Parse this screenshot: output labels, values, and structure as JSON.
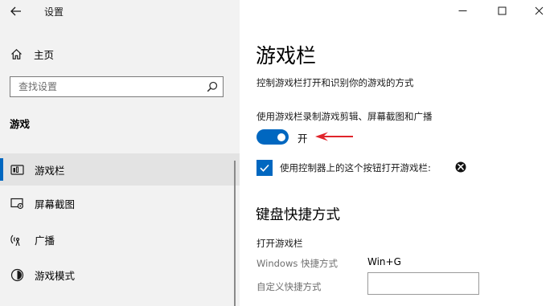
{
  "app": {
    "title": "设置"
  },
  "nav": {
    "home_label": "主页",
    "search_placeholder": "查找设置",
    "section_title": "游戏",
    "items": [
      {
        "label": "游戏栏",
        "icon": "game-bar-icon",
        "active": true
      },
      {
        "label": "屏幕截图",
        "icon": "screen-capture-icon",
        "active": false
      },
      {
        "label": "广播",
        "icon": "broadcast-icon",
        "active": false
      },
      {
        "label": "游戏模式",
        "icon": "game-mode-icon",
        "active": false
      }
    ]
  },
  "window_controls": [
    "minimize-icon",
    "maximize-icon",
    "close-icon"
  ],
  "main": {
    "title": "游戏栏",
    "description": "控制游戏栏打开和识别你的游戏的方式",
    "record_label": "使用游戏栏录制游戏剪辑、屏幕截图和广播",
    "toggle_state": "开",
    "toggle_on": true,
    "checkbox_label": "使用控制器上的这个按钮打开游戏栏:",
    "checkbox_checked": true,
    "keyboard_heading": "键盘快捷方式",
    "open_heading": "打开游戏栏",
    "windows_shortcut_label": "Windows 快捷方式",
    "windows_shortcut_value": "Win+G",
    "custom_shortcut_label": "自定义快捷方式",
    "custom_shortcut_value": ""
  },
  "colors": {
    "accent": "#0067c0",
    "sidebar_bg": "#f2f2f2",
    "annotation_arrow": "#e0242b"
  }
}
